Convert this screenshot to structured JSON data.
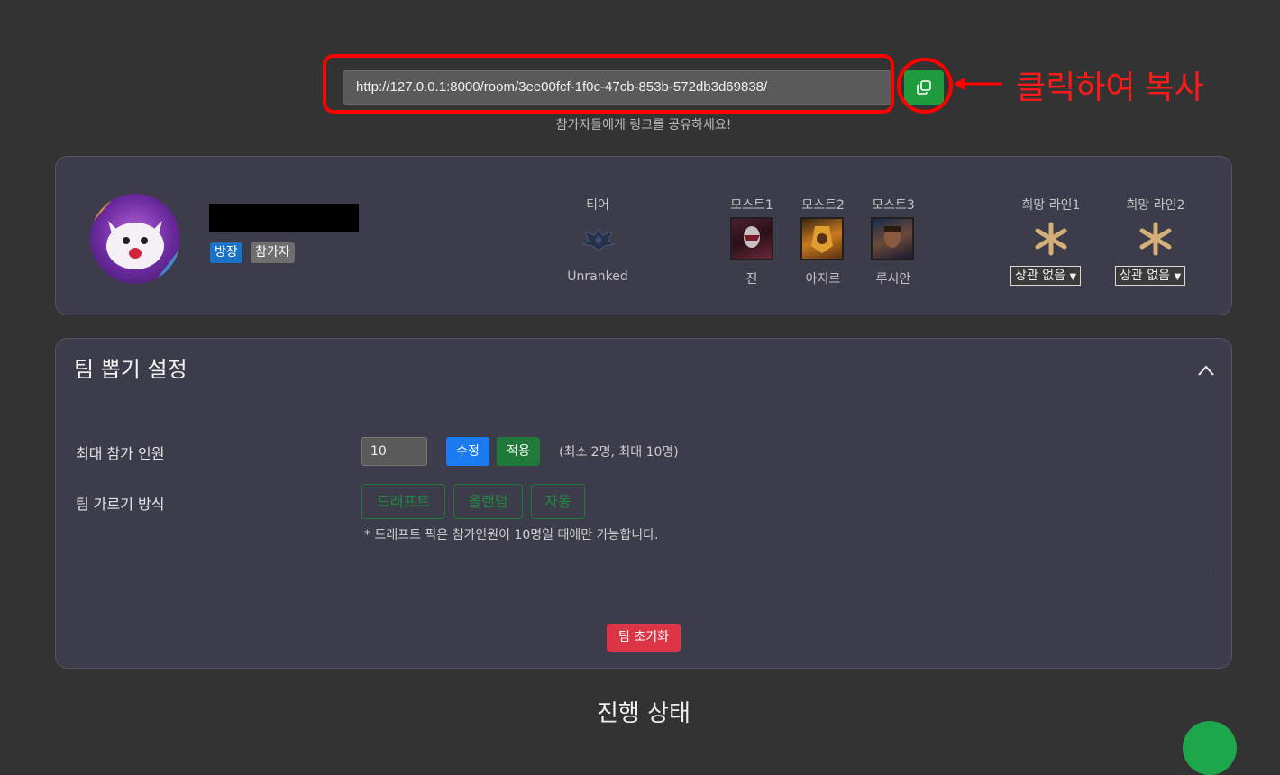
{
  "invite": {
    "link": "http://127.0.0.1:8000/room/3ee00fcf-1f0c-47cb-853b-572db3d69838/",
    "hint": "참가자들에게 링크를 공유하세요!",
    "copy_icon": "copy-icon"
  },
  "annotation": {
    "text": "클릭하여 복사",
    "color": "#ff0000"
  },
  "profile": {
    "badges": {
      "host": "방장",
      "participant": "참가자"
    },
    "tier": {
      "label": "티어",
      "value": "Unranked"
    },
    "most": [
      {
        "label": "모스트1",
        "champion": "진"
      },
      {
        "label": "모스트2",
        "champion": "아지르"
      },
      {
        "label": "모스트3",
        "champion": "루시안"
      }
    ],
    "lanes": [
      {
        "label": "희망 라인1",
        "value": "상관 없음"
      },
      {
        "label": "희망 라인2",
        "value": "상관 없음"
      }
    ]
  },
  "settings": {
    "title": "팀 뽑기 설정",
    "max_label": "최대 참가 인원",
    "max_value": "10",
    "edit_label": "수정",
    "apply_label": "적용",
    "limit_note": "(최소 2명, 최대 10명)",
    "mode_label": "팀 가르기 방식",
    "modes": [
      "드래프트",
      "올랜덤",
      "자동"
    ],
    "draft_note": "* 드래프트 픽은 참가인원이 10명일 때에만 가능합니다.",
    "reset_label": "팀 초기화"
  },
  "status": {
    "title": "진행 상태"
  },
  "colors": {
    "background": "#333333",
    "card": "#3c3c4a",
    "copy_button": "#1e9b3c",
    "accent_blue": "#1a7bf2",
    "danger": "#dc3545"
  }
}
